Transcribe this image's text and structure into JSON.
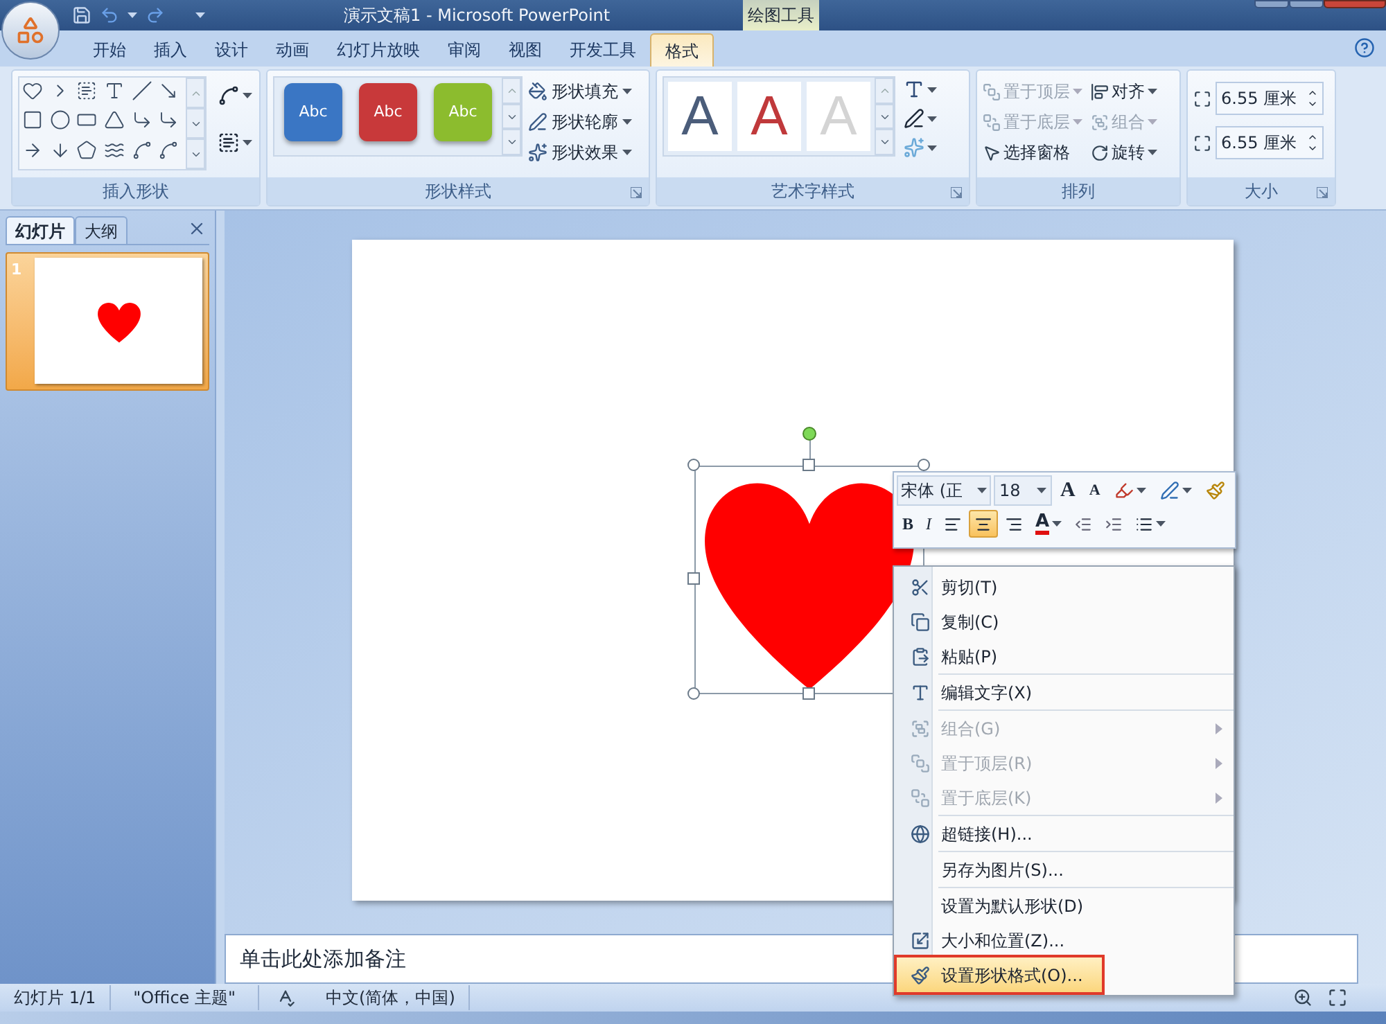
{
  "title_bar": {
    "title": "演示文稿1 - Microsoft PowerPoint",
    "contextual_group": "绘图工具"
  },
  "tabs": [
    {
      "label": "开始",
      "selected": false
    },
    {
      "label": "插入",
      "selected": false
    },
    {
      "label": "设计",
      "selected": false
    },
    {
      "label": "动画",
      "selected": false
    },
    {
      "label": "幻灯片放映",
      "selected": false
    },
    {
      "label": "审阅",
      "selected": false
    },
    {
      "label": "视图",
      "selected": false
    },
    {
      "label": "开发工具",
      "selected": false
    },
    {
      "label": "格式",
      "selected": true
    }
  ],
  "ribbon": {
    "insert_shapes": {
      "label": "插入形状"
    },
    "shape_styles": {
      "label": "形状样式",
      "presets": [
        {
          "text": "Abc",
          "color": "#3a76c4"
        },
        {
          "text": "Abc",
          "color": "#c8393a"
        },
        {
          "text": "Abc",
          "color": "#8cbc2e"
        }
      ],
      "commands": [
        {
          "kind": "fill",
          "label": "形状填充"
        },
        {
          "kind": "outline",
          "label": "形状轮廓"
        },
        {
          "kind": "effects",
          "label": "形状效果"
        }
      ]
    },
    "wordart_styles": {
      "label": "艺术字样式",
      "presets": [
        {
          "text": "A",
          "color": "#4b5d7a"
        },
        {
          "text": "A",
          "color": "#c0393b"
        },
        {
          "text": "A",
          "color": "#d4d4d4"
        }
      ]
    },
    "arrange": {
      "label": "排列",
      "commands": [
        {
          "kind": "front",
          "label": "置于顶层",
          "disabled": true,
          "dropdown": true
        },
        {
          "kind": "align",
          "label": "对齐",
          "disabled": false,
          "dropdown": true
        },
        {
          "kind": "back",
          "label": "置于底层",
          "disabled": true,
          "dropdown": true
        },
        {
          "kind": "group",
          "label": "组合",
          "disabled": true,
          "dropdown": true
        },
        {
          "kind": "pane",
          "label": "选择窗格",
          "disabled": false,
          "dropdown": false
        },
        {
          "kind": "rotate",
          "label": "旋转",
          "disabled": false,
          "dropdown": true
        }
      ]
    },
    "size": {
      "label": "大小",
      "height": "6.55 厘米",
      "width": "6.55 厘米"
    }
  },
  "slide_pane": {
    "tabs": [
      {
        "label": "幻灯片",
        "selected": true
      },
      {
        "label": "大纲",
        "selected": false
      }
    ],
    "thumbnails": [
      {
        "number": "1",
        "selected": true
      }
    ]
  },
  "notes": {
    "prompt": "单击此处添加备注"
  },
  "mini_toolbar": {
    "font": "宋体 (正",
    "size": "18",
    "row1": [
      {
        "kind": "grow",
        "label": "A"
      },
      {
        "kind": "shrink",
        "label": "A"
      },
      {
        "kind": "highlight"
      },
      {
        "kind": "line_color"
      },
      {
        "kind": "painter"
      }
    ],
    "row2": [
      {
        "kind": "bold",
        "label": "B",
        "selected": false
      },
      {
        "kind": "italic",
        "label": "I",
        "selected": false
      },
      {
        "kind": "align_left",
        "selected": false
      },
      {
        "kind": "align_center",
        "selected": true
      },
      {
        "kind": "align_right",
        "selected": false
      },
      {
        "kind": "font_color",
        "label": "A",
        "selected": false
      },
      {
        "kind": "outdent",
        "selected": false
      },
      {
        "kind": "indent",
        "selected": false
      },
      {
        "kind": "bullets",
        "selected": false
      }
    ]
  },
  "context_menu": {
    "sections": [
      [
        {
          "kind": "cut",
          "label": "剪切(T)",
          "disabled": false,
          "submenu": false,
          "selected": false
        },
        {
          "kind": "copy",
          "label": "复制(C)",
          "disabled": false,
          "submenu": false,
          "selected": false
        },
        {
          "kind": "paste",
          "label": "粘贴(P)",
          "disabled": false,
          "submenu": false,
          "selected": false
        }
      ],
      [
        {
          "kind": "edit_text",
          "label": "编辑文字(X)",
          "disabled": false,
          "submenu": false,
          "selected": false
        }
      ],
      [
        {
          "kind": "group",
          "label": "组合(G)",
          "disabled": true,
          "submenu": true,
          "selected": false
        },
        {
          "kind": "front",
          "label": "置于顶层(R)",
          "disabled": true,
          "submenu": true,
          "selected": false
        },
        {
          "kind": "back",
          "label": "置于底层(K)",
          "disabled": true,
          "submenu": true,
          "selected": false
        }
      ],
      [
        {
          "kind": "link",
          "label": "超链接(H)...",
          "disabled": false,
          "submenu": false,
          "selected": false
        }
      ],
      [
        {
          "kind": "plain",
          "label": "另存为图片(S)...",
          "disabled": false,
          "submenu": false,
          "selected": false
        }
      ],
      [
        {
          "kind": "plain",
          "label": "设置为默认形状(D)",
          "disabled": false,
          "submenu": false,
          "selected": false
        },
        {
          "kind": "size",
          "label": "大小和位置(Z)...",
          "disabled": false,
          "submenu": false,
          "selected": false
        },
        {
          "kind": "format",
          "label": "设置形状格式(O)...",
          "disabled": false,
          "submenu": false,
          "selected": true
        }
      ]
    ]
  },
  "status_bar": {
    "slide": "幻灯片 1/1",
    "theme": "\"Office 主题\"",
    "language": "中文(简体，中国)"
  }
}
